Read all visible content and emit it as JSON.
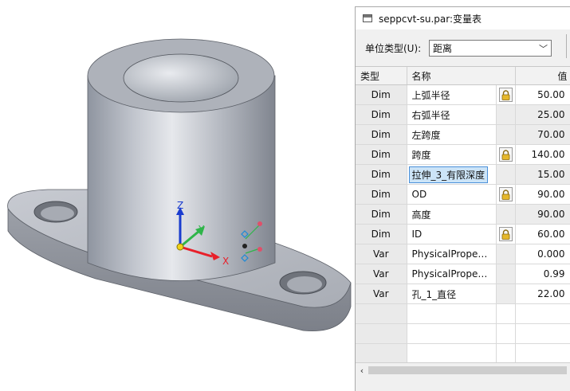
{
  "window": {
    "title": "seppcvt-su.par:变量表"
  },
  "unit_type": {
    "label": "单位类型(U):",
    "value": "距离"
  },
  "table": {
    "headers": {
      "type": "类型",
      "name": "名称",
      "value": "值"
    },
    "rows": [
      {
        "type": "Dim",
        "name": "上弧半径",
        "locked": true,
        "value": "50.00"
      },
      {
        "type": "Dim",
        "name": "右弧半径",
        "locked": false,
        "value": "25.00"
      },
      {
        "type": "Dim",
        "name": "左跨度",
        "locked": false,
        "value": "70.00"
      },
      {
        "type": "Dim",
        "name": "跨度",
        "locked": true,
        "value": "140.00"
      },
      {
        "type": "Dim",
        "name": "拉伸_3_有限深度",
        "locked": false,
        "value": "15.00",
        "selected": true
      },
      {
        "type": "Dim",
        "name": "OD",
        "locked": true,
        "value": "90.00"
      },
      {
        "type": "Dim",
        "name": "高度",
        "locked": false,
        "value": "90.00"
      },
      {
        "type": "Dim",
        "name": "ID",
        "locked": true,
        "value": "60.00"
      },
      {
        "type": "Var",
        "name": "PhysicalPropert...",
        "locked": false,
        "value": "0.000"
      },
      {
        "type": "Var",
        "name": "PhysicalPropert...",
        "locked": false,
        "value": "0.99"
      },
      {
        "type": "Var",
        "name": "孔_1_直径",
        "locked": false,
        "value": "22.00"
      }
    ]
  },
  "axes": {
    "x": "X",
    "y": "Y",
    "z": "Z"
  },
  "colors": {
    "x_axis": "#e8202a",
    "y_axis": "#2fb54a",
    "z_axis": "#1a3ccf",
    "selection": "#cce4f7"
  },
  "icons": {
    "lock": "lock-icon",
    "window": "window-icon",
    "dropdown": "chevron-down-icon",
    "scroll_left": "chevron-left-icon"
  }
}
